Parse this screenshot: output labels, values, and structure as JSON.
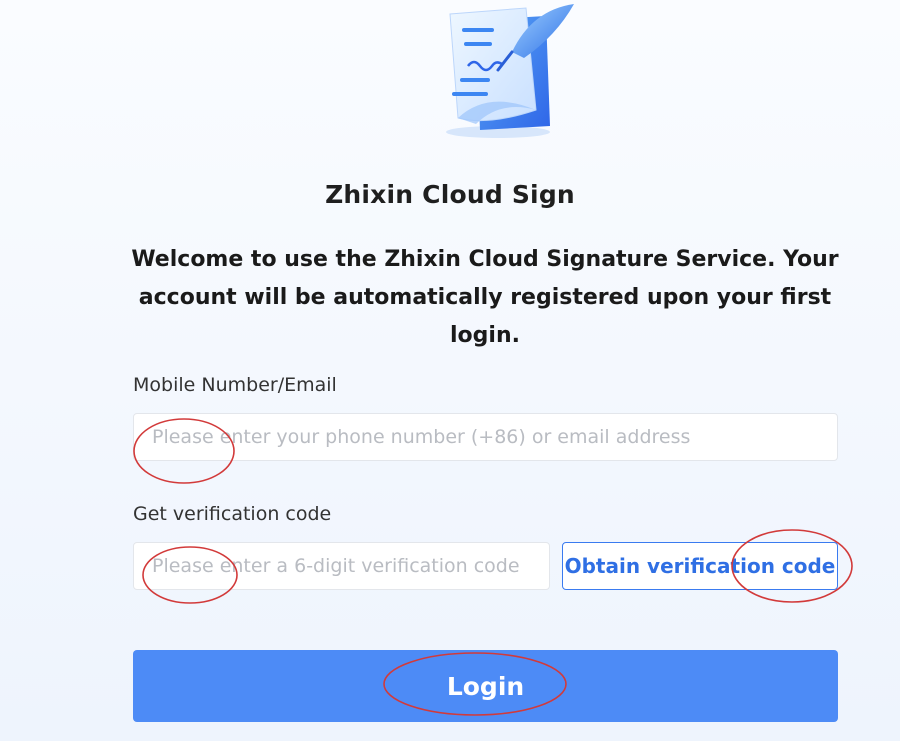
{
  "app": {
    "title": "Zhixin Cloud Sign",
    "welcome_line1": "Welcome to use the Zhixin Cloud Signature Service. Your",
    "welcome_line2": "account will be automatically registered upon your first login."
  },
  "form": {
    "account_label": "Mobile Number/Email",
    "account_placeholder": "Please enter your phone number (+86) or email address",
    "account_value": "",
    "code_label": "Get verification code",
    "code_placeholder": "Please enter a 6-digit verification code",
    "code_value": "",
    "obtain_code_label": "Obtain verification code",
    "login_label": "Login"
  },
  "colors": {
    "accent": "#4d8bf6",
    "annotation": "#d23a3a"
  },
  "icons": {
    "logo": "document-with-quill-icon"
  }
}
